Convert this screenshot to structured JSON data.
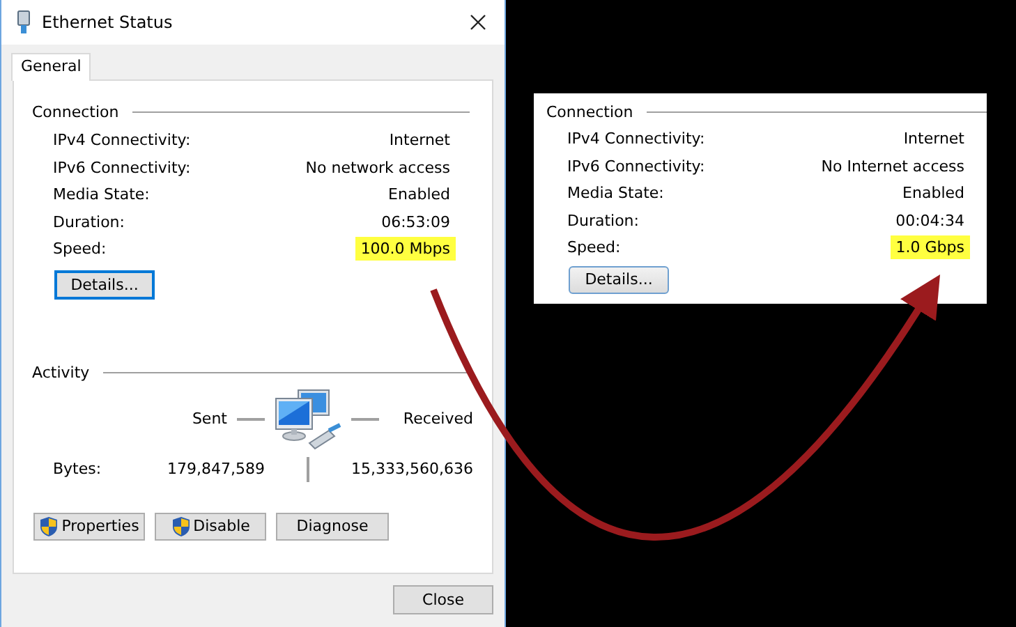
{
  "dialog": {
    "title": "Ethernet Status",
    "tabs": [
      {
        "label": "General",
        "selected": true
      }
    ],
    "connection": {
      "heading": "Connection",
      "rows": [
        {
          "label": "IPv4 Connectivity:",
          "value": "Internet",
          "highlighted": false
        },
        {
          "label": "IPv6 Connectivity:",
          "value": "No network access",
          "highlighted": false
        },
        {
          "label": "Media State:",
          "value": "Enabled",
          "highlighted": false
        },
        {
          "label": "Duration:",
          "value": "06:53:09",
          "highlighted": false
        },
        {
          "label": "Speed:",
          "value": "100.0 Mbps",
          "highlighted": true
        }
      ]
    },
    "details_button": "Details...",
    "activity": {
      "heading": "Activity",
      "sent_label": "Sent",
      "received_label": "Received",
      "bytes_label": "Bytes:",
      "sent": "179,847,589",
      "received": "15,333,560,636"
    },
    "buttons": [
      {
        "label": "Properties",
        "shield": true
      },
      {
        "label": "Disable",
        "shield": true
      },
      {
        "label": "Diagnose",
        "shield": false
      }
    ],
    "close_button": "Close"
  },
  "inset": {
    "heading": "Connection",
    "rows": [
      {
        "label": "IPv4 Connectivity:",
        "value": "Internet",
        "highlighted": false
      },
      {
        "label": "IPv6 Connectivity:",
        "value": "No Internet access",
        "highlighted": false
      },
      {
        "label": "Media State:",
        "value": "Enabled",
        "highlighted": false
      },
      {
        "label": "Duration:",
        "value": "00:04:34",
        "highlighted": false
      },
      {
        "label": "Speed:",
        "value": "1.0 Gbps",
        "highlighted": true
      }
    ],
    "details_button": "Details..."
  }
}
